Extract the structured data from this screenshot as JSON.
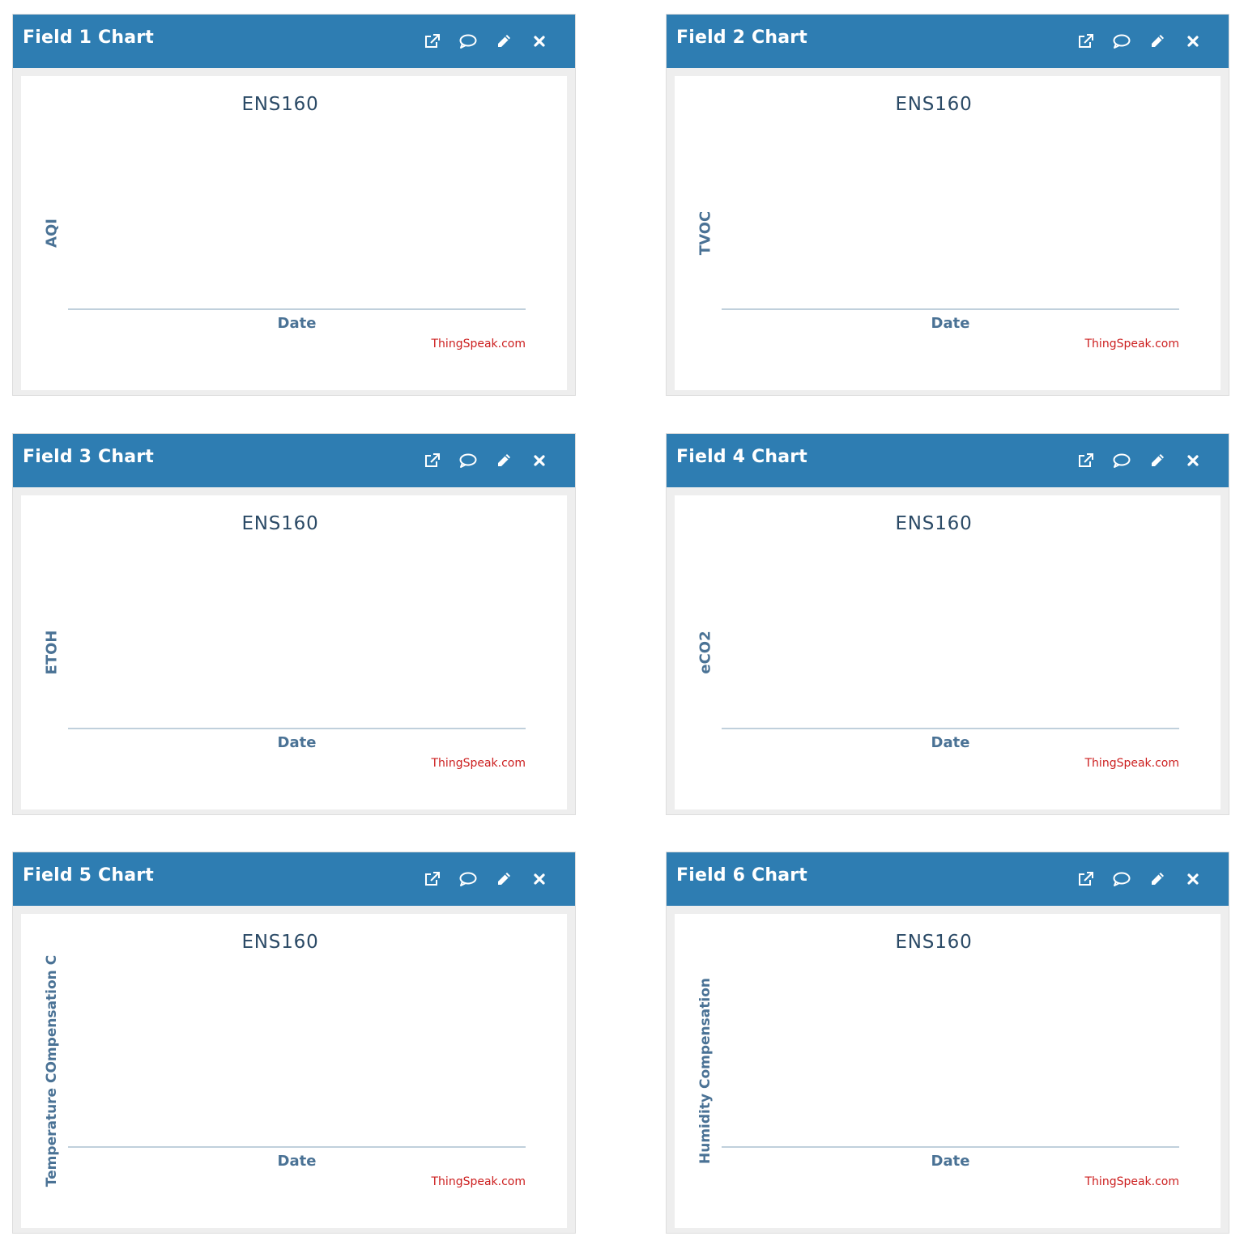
{
  "panels": [
    {
      "title": "Field 1 Chart",
      "chart_title": "ENS160",
      "ylabel": "AQI",
      "xlabel": "Date",
      "credit": "ThingSpeak.com"
    },
    {
      "title": "Field 2 Chart",
      "chart_title": "ENS160",
      "ylabel": "TVOC",
      "xlabel": "Date",
      "credit": "ThingSpeak.com"
    },
    {
      "title": "Field 3 Chart",
      "chart_title": "ENS160",
      "ylabel": "ETOH",
      "xlabel": "Date",
      "credit": "ThingSpeak.com"
    },
    {
      "title": "Field 4 Chart",
      "chart_title": "ENS160",
      "ylabel": "eCO2",
      "xlabel": "Date",
      "credit": "ThingSpeak.com"
    },
    {
      "title": "Field 5 Chart",
      "chart_title": "ENS160",
      "ylabel": "Temperature COmpensation C",
      "xlabel": "Date",
      "credit": "ThingSpeak.com"
    },
    {
      "title": "Field 6 Chart",
      "chart_title": "ENS160",
      "ylabel": "Humidity Compensation",
      "xlabel": "Date",
      "credit": "ThingSpeak.com"
    }
  ],
  "toolbar_icons": [
    "external-link-icon",
    "comment-icon",
    "pencil-icon",
    "close-icon"
  ],
  "colors": {
    "header": "#2e7db2",
    "title_text": "#2b4a66",
    "axis_label": "#4a7295",
    "axis_line": "#c0d0dc",
    "credit": "#cc1e1e"
  }
}
